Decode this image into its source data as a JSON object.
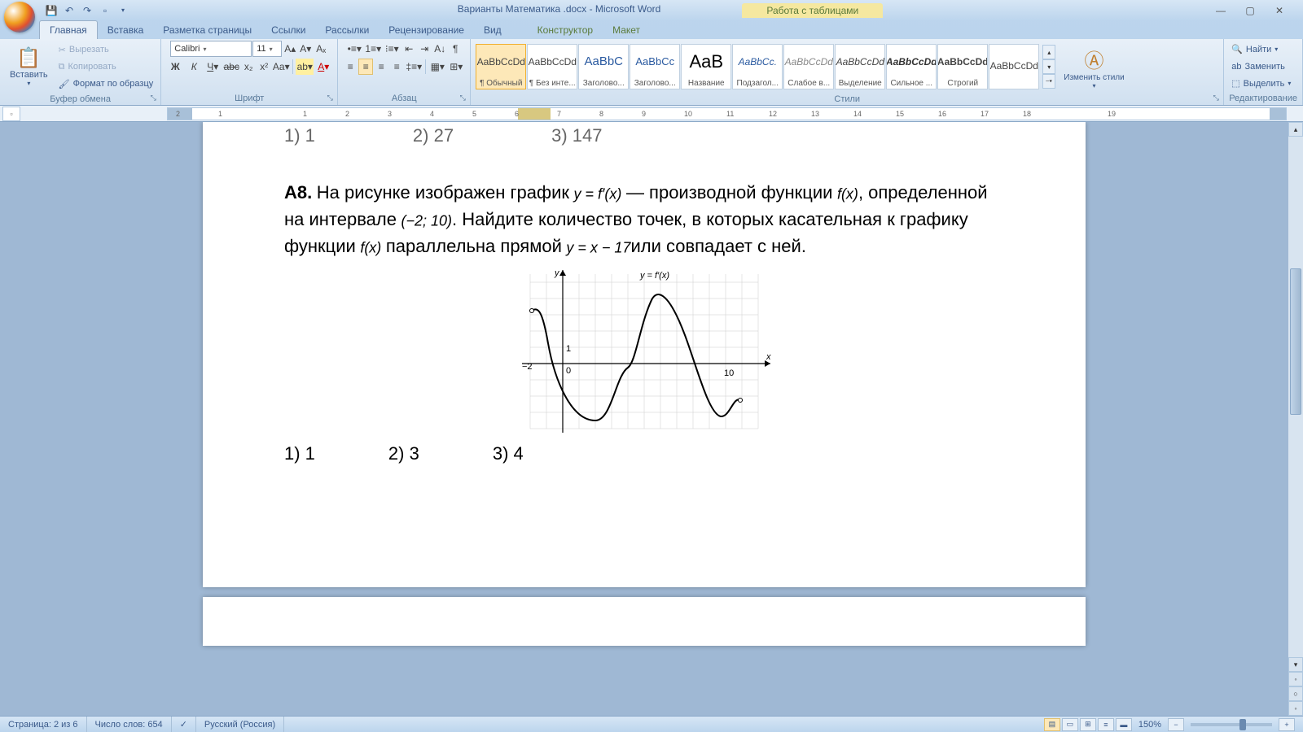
{
  "title": "Варианты Математика .docx - Microsoft Word",
  "table_tools": "Работа с таблицами",
  "tabs": [
    "Главная",
    "Вставка",
    "Разметка страницы",
    "Ссылки",
    "Рассылки",
    "Рецензирование",
    "Вид"
  ],
  "context_tabs": [
    "Конструктор",
    "Макет"
  ],
  "clipboard": {
    "paste": "Вставить",
    "cut": "Вырезать",
    "copy": "Копировать",
    "format_painter": "Формат по образцу",
    "group": "Буфер обмена"
  },
  "font": {
    "name": "Calibri",
    "size": "11",
    "group": "Шрифт"
  },
  "paragraph": {
    "group": "Абзац"
  },
  "styles": {
    "group": "Стили",
    "change": "Изменить стили",
    "items": [
      {
        "preview": "AaBbCcDd",
        "label": "¶ Обычный"
      },
      {
        "preview": "AaBbCcDd",
        "label": "¶ Без инте..."
      },
      {
        "preview": "AaBbC",
        "label": "Заголово..."
      },
      {
        "preview": "AaBbCc",
        "label": "Заголово..."
      },
      {
        "preview": "AaB",
        "label": "Название"
      },
      {
        "preview": "AaBbCc.",
        "label": "Подзагол..."
      },
      {
        "preview": "AaBbCcDd",
        "label": "Слабое в..."
      },
      {
        "preview": "AaBbCcDd",
        "label": "Выделение"
      },
      {
        "preview": "AaBbCcDd",
        "label": "Сильное ..."
      },
      {
        "preview": "AaBbCcDd",
        "label": "Строгий"
      },
      {
        "preview": "AaBbCcDd",
        "label": ""
      }
    ]
  },
  "editing": {
    "find": "Найти",
    "replace": "Заменить",
    "select": "Выделить",
    "group": "Редактирование"
  },
  "document": {
    "partial_answers": [
      "1) 1",
      "2) 27",
      "3) 147"
    ],
    "problem_label": "A8.",
    "text1": "На рисунке изображен график",
    "expr1": "y = f′(x)",
    "text2": "— производной функции",
    "expr2": "f(x)",
    "text3": ", определенной на интервале",
    "expr3": "(−2; 10)",
    "text4": ". Найдите количество точек, в которых касательная к графику функции",
    "expr4": "f(x)",
    "text5": "параллельна прямой",
    "expr5": "y = x − 17",
    "text6": "или совпадает с ней.",
    "graph_label": "y = f′(x)",
    "axis_x_neg": "−2",
    "axis_zero": "0",
    "axis_one": "1",
    "axis_ten": "10",
    "axis_y": "y",
    "axis_x": "x",
    "answers": [
      "1) 1",
      "2) 3",
      "3) 4"
    ]
  },
  "status": {
    "page": "Страница: 2 из 6",
    "words": "Число слов: 654",
    "lang": "Русский (Россия)",
    "zoom": "150%"
  },
  "ruler_marks": [
    "2",
    "1",
    "",
    "1",
    "2",
    "3",
    "4",
    "5",
    "6",
    "7",
    "8",
    "9",
    "10",
    "11",
    "12",
    "13",
    "14",
    "15",
    "16",
    "17",
    "18",
    "",
    "19"
  ]
}
